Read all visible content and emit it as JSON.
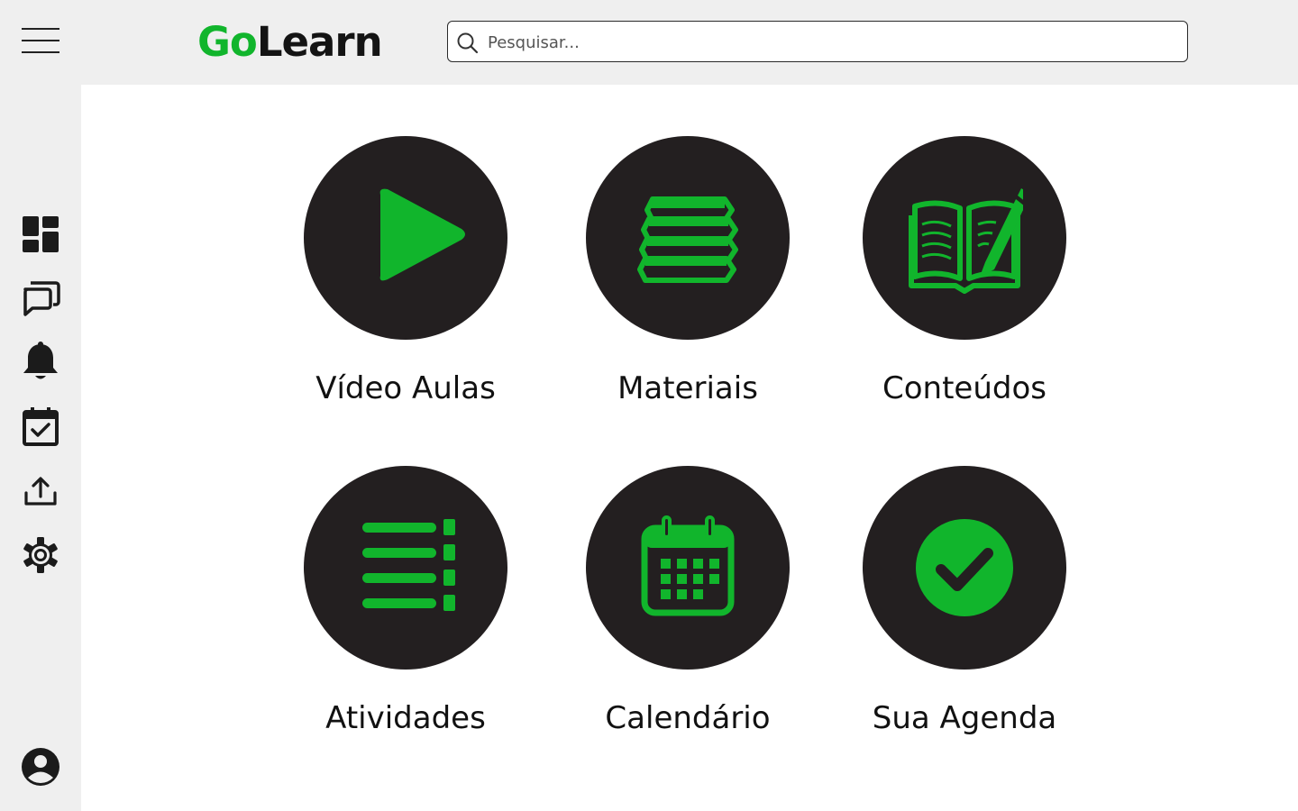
{
  "app": {
    "logo_part1": "Go",
    "logo_part2": "Learn"
  },
  "search": {
    "placeholder": "Pesquisar..."
  },
  "sidebar": {
    "items": [
      {
        "icon": "dashboard-icon"
      },
      {
        "icon": "chat-icon"
      },
      {
        "icon": "bell-icon"
      },
      {
        "icon": "calendar-check-icon"
      },
      {
        "icon": "upload-icon"
      },
      {
        "icon": "gear-icon"
      }
    ],
    "profile_icon": "user-avatar-icon"
  },
  "tiles": [
    {
      "label": "Vídeo Aulas",
      "icon": "play-icon"
    },
    {
      "label": "Materiais",
      "icon": "books-icon"
    },
    {
      "label": "Conteúdos",
      "icon": "open-book-pencil-icon"
    },
    {
      "label": "Atividades",
      "icon": "list-icon"
    },
    {
      "label": "Calendário",
      "icon": "calendar-icon"
    },
    {
      "label": "Sua Agenda",
      "icon": "check-circle-icon"
    }
  ],
  "colors": {
    "accent": "#11b52c",
    "circle": "#231f20",
    "background": "#efefef",
    "content": "#ffffff"
  }
}
